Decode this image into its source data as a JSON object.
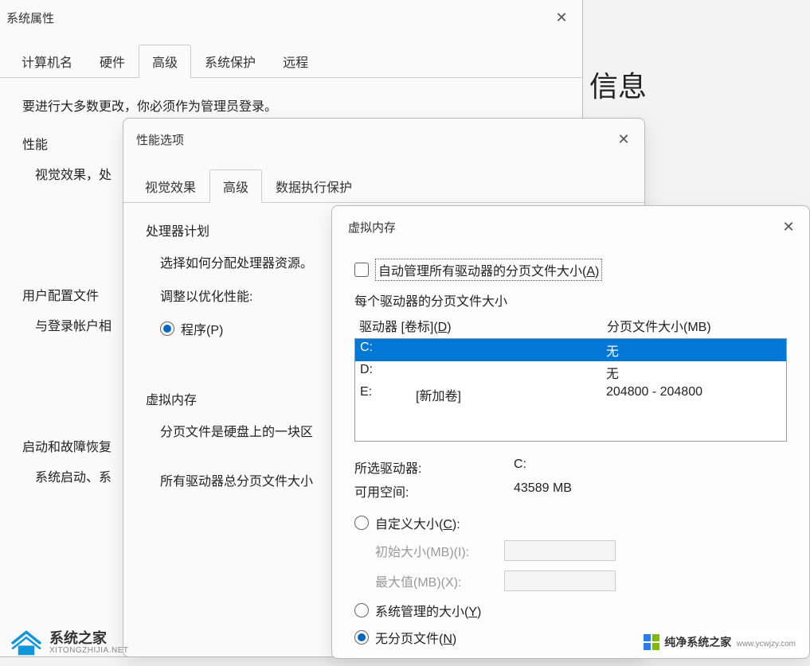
{
  "bg_heading": "信息",
  "win1": {
    "title": "系统属性",
    "tabs": [
      "计算机名",
      "硬件",
      "高级",
      "系统保护",
      "远程"
    ],
    "intro": "要进行大多数更改，你必须作为管理员登录。",
    "perf": {
      "head": "性能",
      "text": "视觉效果，处"
    },
    "profile": {
      "head": "用户配置文件",
      "text": "与登录帐户相"
    },
    "startup": {
      "head": "启动和故障恢复",
      "text": "系统启动、系"
    }
  },
  "win2": {
    "title": "性能选项",
    "tabs": [
      "视觉效果",
      "高级",
      "数据执行保护"
    ],
    "sched": {
      "head": "处理器计划",
      "sub": "选择如何分配处理器资源。",
      "adjust": "调整以优化性能:",
      "radio_programs": "程序(P)"
    },
    "vm": {
      "head": "虚拟内存",
      "desc": "分页文件是硬盘上的一块区",
      "total": "所有驱动器总分页文件大小"
    }
  },
  "win3": {
    "title": "虚拟内存",
    "auto_manage": "自动管理所有驱动器的分页文件大小(A)",
    "per_drive_label": "每个驱动器的分页文件大小",
    "col_drive": "驱动器 [卷标](D)",
    "col_size": "分页文件大小(MB)",
    "drives": [
      {
        "d": "C:",
        "label": "",
        "size": "无"
      },
      {
        "d": "D:",
        "label": "",
        "size": "无"
      },
      {
        "d": "E:",
        "label": "[新加卷]",
        "size": "204800 - 204800"
      }
    ],
    "selected_label": "所选驱动器:",
    "selected_value": "C:",
    "avail_label": "可用空间:",
    "avail_value": "43589 MB",
    "custom_size": "自定义大小(C):",
    "initial_label": "初始大小(MB)(I):",
    "max_label": "最大值(MB)(X):",
    "system_managed": "系统管理的大小(Y)",
    "no_paging": "无分页文件(N)"
  },
  "watermark_left": {
    "name": "系统之家",
    "domain": "XITONGZHIJIA.NET"
  },
  "watermark_right": {
    "name": "纯净系统之家",
    "domain": "www.ycwjzy.com"
  }
}
